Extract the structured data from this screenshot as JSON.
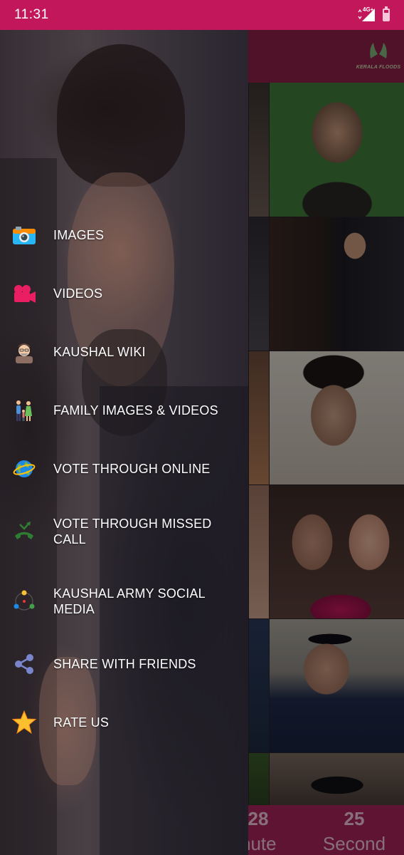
{
  "status_bar": {
    "time": "11:31",
    "network_label": "4G+",
    "icons": [
      "signal-icon",
      "battery-icon"
    ]
  },
  "toolbar": {
    "logo_text": "KERALA FLOODS",
    "color": "#8a1f45"
  },
  "drawer": {
    "menu_items": [
      {
        "label": "IMAGES",
        "icon": "camera-icon"
      },
      {
        "label": "VIDEOS",
        "icon": "video-camera-icon"
      },
      {
        "label": "KAUSHAL WIKI",
        "icon": "person-icon"
      },
      {
        "label": "FAMILY IMAGES & VIDEOS",
        "icon": "family-icon"
      },
      {
        "label": "VOTE THROUGH ONLINE",
        "icon": "globe-icon"
      },
      {
        "label": "VOTE THROUGH MISSED CALL",
        "icon": "missed-call-icon"
      },
      {
        "label": "KAUSHAL ARMY SOCIAL MEDIA",
        "icon": "social-network-icon"
      },
      {
        "label": "SHARE WITH FRIENDS",
        "icon": "share-icon"
      },
      {
        "label": "RATE US",
        "icon": "star-icon"
      }
    ]
  },
  "counter": {
    "minutes_value": "28",
    "minutes_unit": "nute",
    "seconds_value": "25",
    "seconds_unit": "Second"
  },
  "colors": {
    "status_bar": "#c2185b",
    "counter_bar": "#a5245a",
    "accent": "#e91e63"
  }
}
